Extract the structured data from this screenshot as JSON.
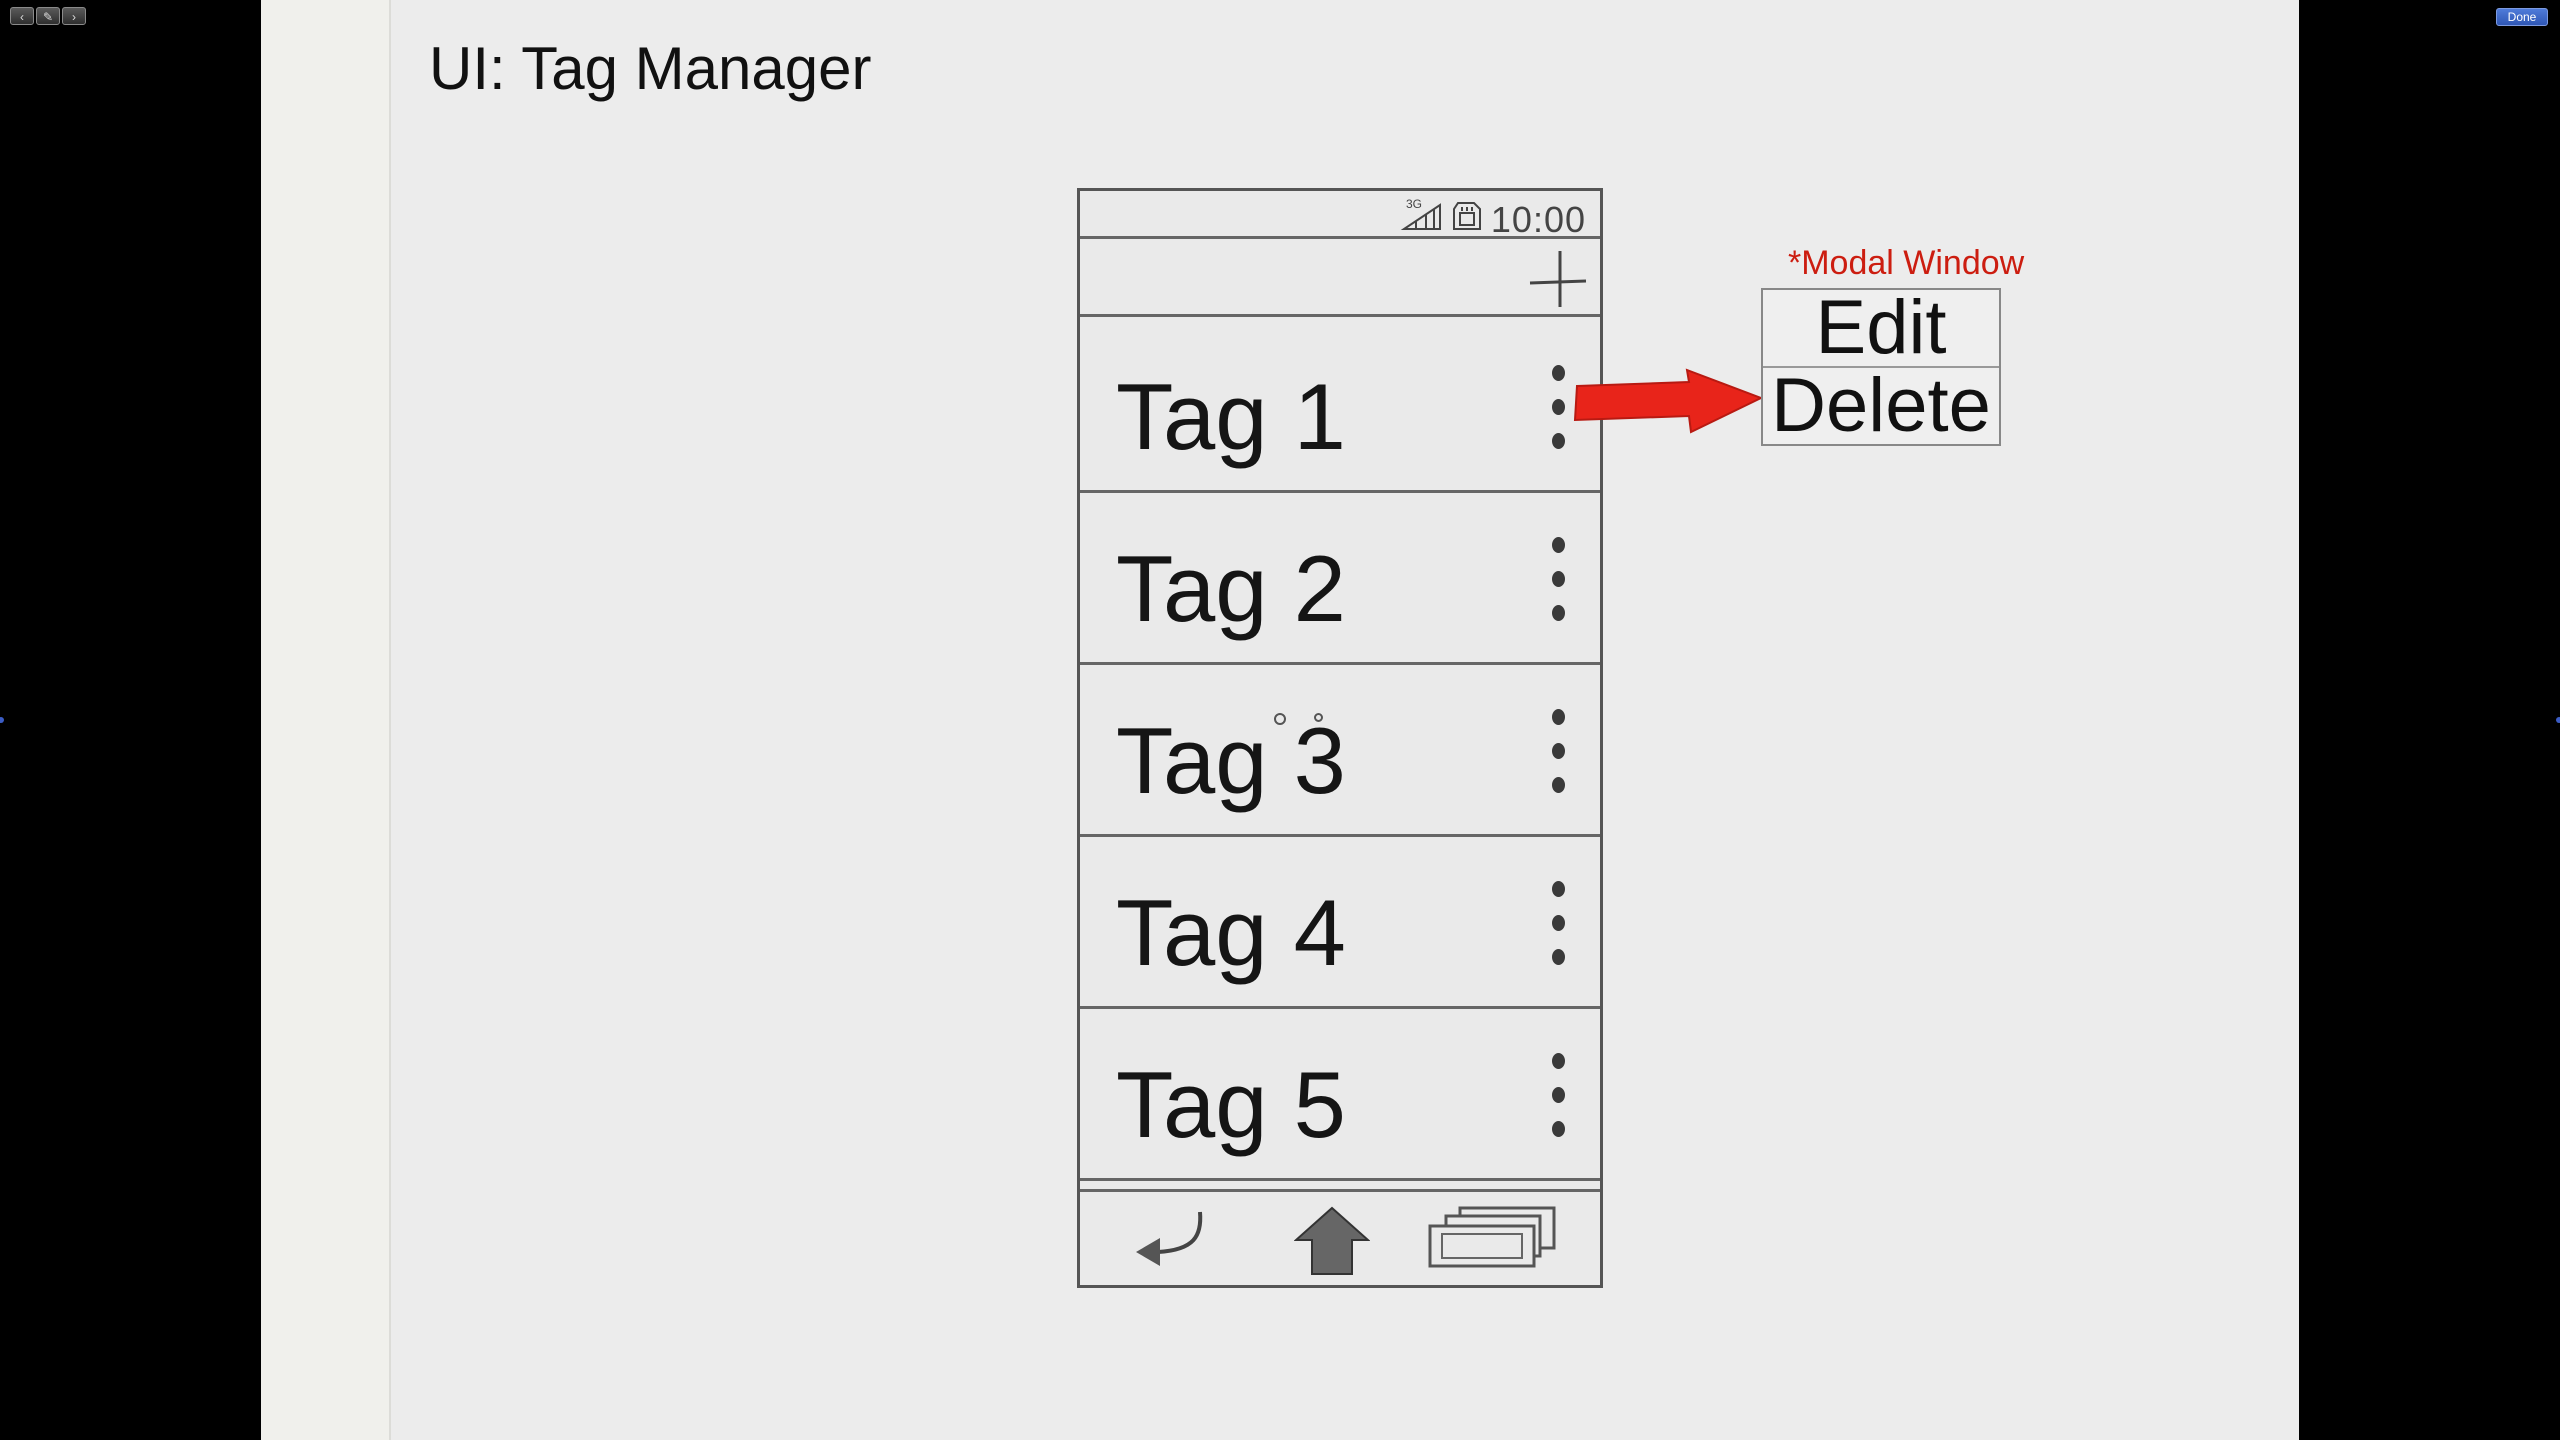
{
  "viewer": {
    "prev_icon": "chevron-left-icon",
    "tools_icon": "pencil-icon",
    "next_icon": "chevron-right-icon",
    "done_label": "Done"
  },
  "slide": {
    "title": "UI: Tag Manager"
  },
  "phone": {
    "status": {
      "time": "10:00",
      "signal_icon": "signal-3g-icon",
      "storage_icon": "sd-card-icon"
    },
    "action_bar": {
      "add_icon": "plus-icon"
    },
    "tags": [
      {
        "label": "Tag 1"
      },
      {
        "label": "Tag 2"
      },
      {
        "label": "Tag 3"
      },
      {
        "label": "Tag 4"
      },
      {
        "label": "Tag 5"
      }
    ],
    "overflow_icon": "more-vertical-icon",
    "bottom_nav": {
      "back_icon": "back-arrow-icon",
      "home_icon": "home-icon",
      "recents_icon": "recent-apps-icon"
    }
  },
  "modal": {
    "note": "*Modal Window",
    "items": [
      {
        "label": "Edit"
      },
      {
        "label": "Delete"
      }
    ],
    "arrow_color": "#e8241a"
  },
  "colors": {
    "annotation": "#cc1d10",
    "arrow": "#e8241a",
    "accent_button": "#2f57b5"
  }
}
